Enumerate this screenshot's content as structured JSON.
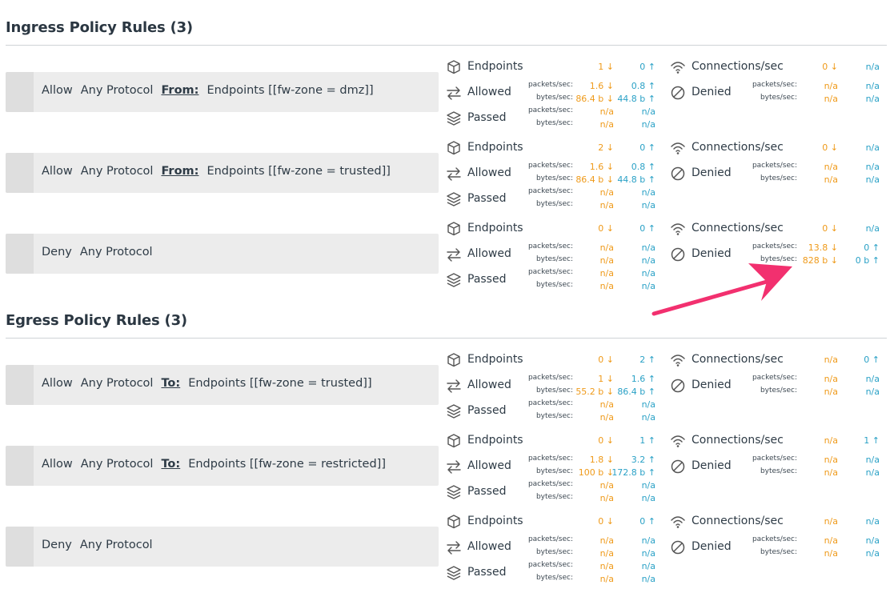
{
  "ingress": {
    "title": "Ingress Policy Rules (3)",
    "rules": [
      {
        "action": "Allow",
        "protocol": "Any Protocol",
        "dir_label": "From:",
        "target": "Endpoints [[fw-zone = dmz]]",
        "endpoints": {
          "label": "Endpoints",
          "in": "1 ↓",
          "out": "0 ↑"
        },
        "allowed": {
          "label": "Allowed",
          "pk_label": "packets/sec:",
          "by_label": "bytes/sec:",
          "pk_in": "1.6 ↓",
          "pk_out": "0.8 ↑",
          "by_in": "86.4 b ↓",
          "by_out": "44.8 b ↑"
        },
        "passed": {
          "label": "Passed",
          "pk_label": "packets/sec:",
          "by_label": "bytes/sec:",
          "pk_in": "n/a",
          "pk_out": "n/a",
          "by_in": "n/a",
          "by_out": "n/a"
        },
        "conn": {
          "label": "Connections/sec",
          "in": "0 ↓",
          "out": "n/a"
        },
        "denied": {
          "label": "Denied",
          "pk_label": "packets/sec:",
          "by_label": "bytes/sec:",
          "pk_in": "n/a",
          "pk_out": "n/a",
          "by_in": "n/a",
          "by_out": "n/a"
        }
      },
      {
        "action": "Allow",
        "protocol": "Any Protocol",
        "dir_label": "From:",
        "target": "Endpoints [[fw-zone = trusted]]",
        "endpoints": {
          "label": "Endpoints",
          "in": "2 ↓",
          "out": "0 ↑"
        },
        "allowed": {
          "label": "Allowed",
          "pk_label": "packets/sec:",
          "by_label": "bytes/sec:",
          "pk_in": "1.6 ↓",
          "pk_out": "0.8 ↑",
          "by_in": "86.4 b ↓",
          "by_out": "44.8 b ↑"
        },
        "passed": {
          "label": "Passed",
          "pk_label": "packets/sec:",
          "by_label": "bytes/sec:",
          "pk_in": "n/a",
          "pk_out": "n/a",
          "by_in": "n/a",
          "by_out": "n/a"
        },
        "conn": {
          "label": "Connections/sec",
          "in": "0 ↓",
          "out": "n/a"
        },
        "denied": {
          "label": "Denied",
          "pk_label": "packets/sec:",
          "by_label": "bytes/sec:",
          "pk_in": "n/a",
          "pk_out": "n/a",
          "by_in": "n/a",
          "by_out": "n/a"
        }
      },
      {
        "action": "Deny",
        "protocol": "Any Protocol",
        "dir_label": "",
        "target": "",
        "endpoints": {
          "label": "Endpoints",
          "in": "0 ↓",
          "out": "0 ↑"
        },
        "allowed": {
          "label": "Allowed",
          "pk_label": "packets/sec:",
          "by_label": "bytes/sec:",
          "pk_in": "n/a",
          "pk_out": "n/a",
          "by_in": "n/a",
          "by_out": "n/a"
        },
        "passed": {
          "label": "Passed",
          "pk_label": "packets/sec:",
          "by_label": "bytes/sec:",
          "pk_in": "n/a",
          "pk_out": "n/a",
          "by_in": "n/a",
          "by_out": "n/a"
        },
        "conn": {
          "label": "Connections/sec",
          "in": "0 ↓",
          "out": "n/a"
        },
        "denied": {
          "label": "Denied",
          "pk_label": "packets/sec:",
          "by_label": "bytes/sec:",
          "pk_in": "13.8 ↓",
          "pk_out": "0 ↑",
          "by_in": "828 b ↓",
          "by_out": "0 b ↑"
        }
      }
    ]
  },
  "egress": {
    "title": "Egress Policy Rules (3)",
    "rules": [
      {
        "action": "Allow",
        "protocol": "Any Protocol",
        "dir_label": "To:",
        "target": "Endpoints [[fw-zone = trusted]]",
        "endpoints": {
          "label": "Endpoints",
          "in": "0 ↓",
          "out": "2 ↑"
        },
        "allowed": {
          "label": "Allowed",
          "pk_label": "packets/sec:",
          "by_label": "bytes/sec:",
          "pk_in": "1 ↓",
          "pk_out": "1.6 ↑",
          "by_in": "55.2 b ↓",
          "by_out": "86.4 b ↑"
        },
        "passed": {
          "label": "Passed",
          "pk_label": "packets/sec:",
          "by_label": "bytes/sec:",
          "pk_in": "n/a",
          "pk_out": "n/a",
          "by_in": "n/a",
          "by_out": "n/a"
        },
        "conn": {
          "label": "Connections/sec",
          "in": "n/a",
          "out": "0 ↑"
        },
        "denied": {
          "label": "Denied",
          "pk_label": "packets/sec:",
          "by_label": "bytes/sec:",
          "pk_in": "n/a",
          "pk_out": "n/a",
          "by_in": "n/a",
          "by_out": "n/a"
        }
      },
      {
        "action": "Allow",
        "protocol": "Any Protocol",
        "dir_label": "To:",
        "target": "Endpoints [[fw-zone = restricted]]",
        "endpoints": {
          "label": "Endpoints",
          "in": "0 ↓",
          "out": "1 ↑"
        },
        "allowed": {
          "label": "Allowed",
          "pk_label": "packets/sec:",
          "by_label": "bytes/sec:",
          "pk_in": "1.8 ↓",
          "pk_out": "3.2 ↑",
          "by_in": "100 b ↓",
          "by_out": "172.8 b ↑"
        },
        "passed": {
          "label": "Passed",
          "pk_label": "packets/sec:",
          "by_label": "bytes/sec:",
          "pk_in": "n/a",
          "pk_out": "n/a",
          "by_in": "n/a",
          "by_out": "n/a"
        },
        "conn": {
          "label": "Connections/sec",
          "in": "n/a",
          "out": "1 ↑"
        },
        "denied": {
          "label": "Denied",
          "pk_label": "packets/sec:",
          "by_label": "bytes/sec:",
          "pk_in": "n/a",
          "pk_out": "n/a",
          "by_in": "n/a",
          "by_out": "n/a"
        }
      },
      {
        "action": "Deny",
        "protocol": "Any Protocol",
        "dir_label": "",
        "target": "",
        "endpoints": {
          "label": "Endpoints",
          "in": "0 ↓",
          "out": "0 ↑"
        },
        "allowed": {
          "label": "Allowed",
          "pk_label": "packets/sec:",
          "by_label": "bytes/sec:",
          "pk_in": "n/a",
          "pk_out": "n/a",
          "by_in": "n/a",
          "by_out": "n/a"
        },
        "passed": {
          "label": "Passed",
          "pk_label": "packets/sec:",
          "by_label": "bytes/sec:",
          "pk_in": "n/a",
          "pk_out": "n/a",
          "by_in": "n/a",
          "by_out": "n/a"
        },
        "conn": {
          "label": "Connections/sec",
          "in": "n/a",
          "out": "n/a"
        },
        "denied": {
          "label": "Denied",
          "pk_label": "packets/sec:",
          "by_label": "bytes/sec:",
          "pk_in": "n/a",
          "pk_out": "n/a",
          "by_in": "n/a",
          "by_out": "n/a"
        }
      }
    ]
  },
  "colors": {
    "inbound": "#ef9a1a",
    "outbound": "#2aa1c6",
    "annotation_arrow": "#f2306f",
    "rule_bg": "#ececec"
  },
  "icons": [
    "cube-icon",
    "arrows-exchange-icon",
    "layers-icon",
    "wifi-icon",
    "prohibited-icon"
  ]
}
